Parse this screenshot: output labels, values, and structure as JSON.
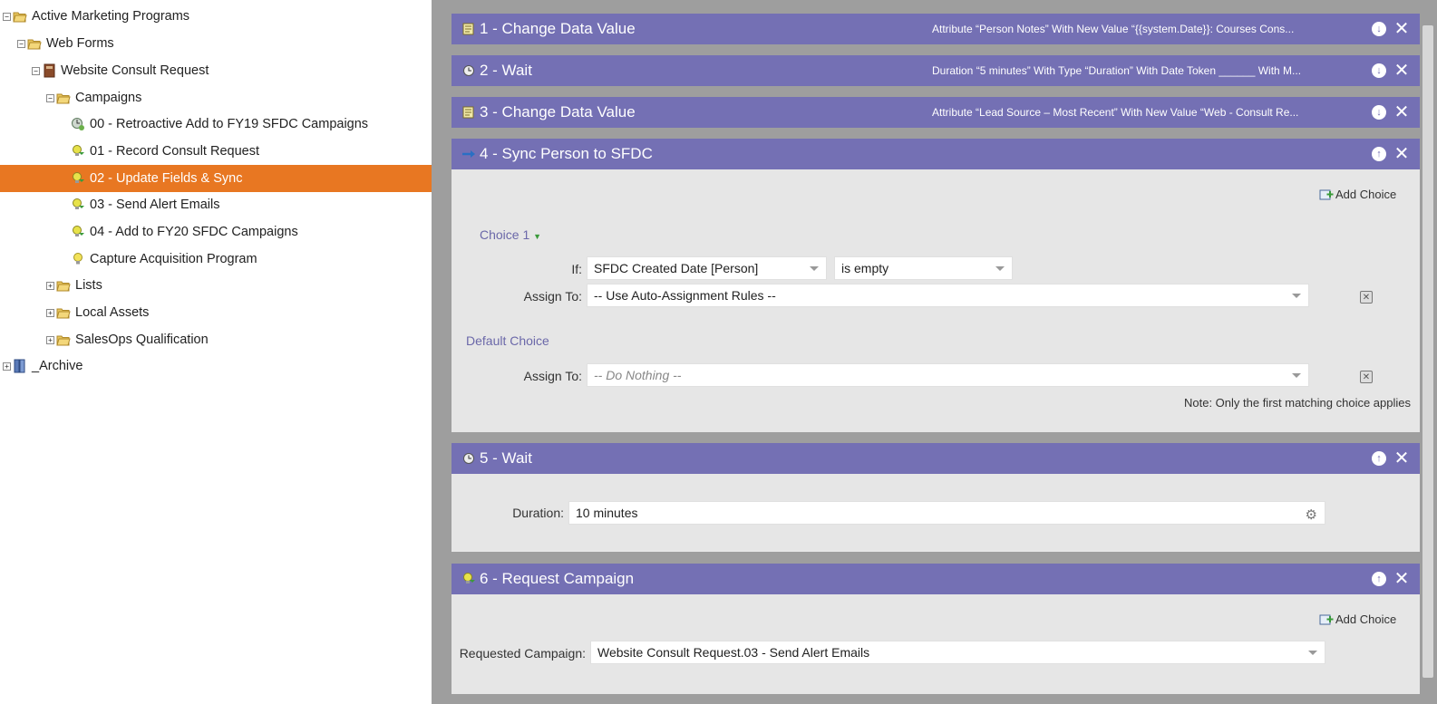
{
  "tree": {
    "items": [
      {
        "label": "Active Marketing Programs"
      },
      {
        "label": "Web Forms"
      },
      {
        "label": "Website Consult Request"
      },
      {
        "label": "Campaigns"
      },
      {
        "label": "00 - Retroactive Add to FY19 SFDC Campaigns"
      },
      {
        "label": "01 - Record Consult Request"
      },
      {
        "label": "02 - Update Fields & Sync"
      },
      {
        "label": "03 - Send Alert Emails"
      },
      {
        "label": "04 - Add to FY20 SFDC Campaigns"
      },
      {
        "label": "Capture Acquisition Program"
      },
      {
        "label": "Lists"
      },
      {
        "label": "Local Assets"
      },
      {
        "label": "SalesOps Qualification"
      },
      {
        "label": "_Archive"
      }
    ],
    "selected_index": 6
  },
  "flow": {
    "steps": [
      {
        "title": "1 - Change Data Value",
        "summary": "Attribute “Person Notes” With New Value “{{system.Date}}: Courses Cons...",
        "icon": "change-data-icon"
      },
      {
        "title": "2 - Wait",
        "summary": "Duration “5 minutes” With Type “Duration” With Date Token ______ With M...",
        "icon": "wait-icon"
      },
      {
        "title": "3 - Change Data Value",
        "summary": "Attribute “Lead Source – Most Recent” With New Value “Web - Consult Re...",
        "icon": "change-data-icon"
      },
      {
        "title": "4 - Sync Person to SFDC",
        "summary": "",
        "icon": "sync-icon"
      },
      {
        "title": "5 - Wait",
        "summary": "",
        "icon": "wait-icon"
      },
      {
        "title": "6 - Request Campaign",
        "summary": "",
        "icon": "request-campaign-icon"
      }
    ],
    "sync": {
      "add_choice": "Add Choice",
      "choice1_label": "Choice 1",
      "if_label": "If:",
      "if_field": "SFDC Created Date [Person]",
      "if_operator": "is empty",
      "assign_label": "Assign To:",
      "assign_value": "-- Use Auto-Assignment Rules --",
      "default_label": "Default Choice",
      "default_assign_label": "Assign To:",
      "default_assign_value": "-- Do Nothing --",
      "note": "Note: Only the first matching choice applies"
    },
    "wait": {
      "duration_label": "Duration:",
      "duration_value": "10 minutes"
    },
    "request": {
      "add_choice": "Add Choice",
      "requested_label": "Requested Campaign:",
      "requested_value": "Website Consult Request.03 - Send Alert Emails"
    }
  }
}
